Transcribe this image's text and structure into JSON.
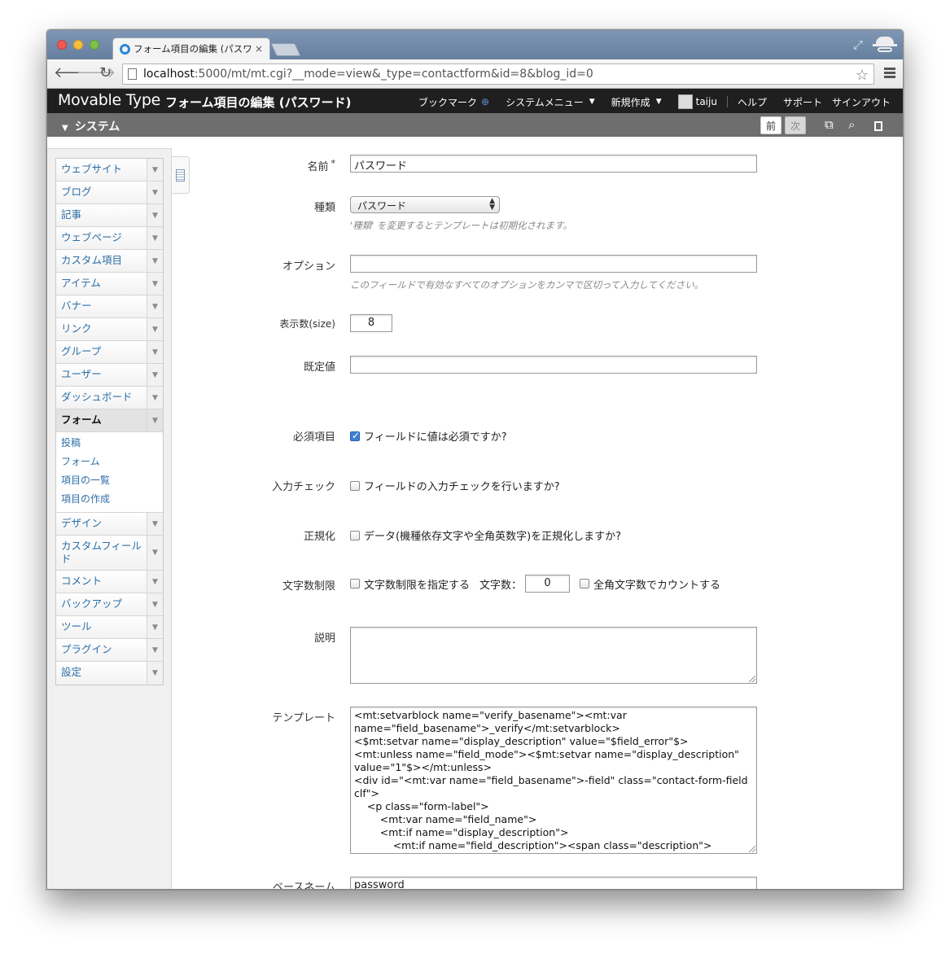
{
  "browser": {
    "tab_title": "フォーム項目の編集 (パスワ",
    "tab_close": "×",
    "url_host": "localhost",
    "url_path": ":5000/mt/mt.cgi?__mode=view&_type=contactform&id=8&blog_id=0"
  },
  "header": {
    "logo": "Movable Type",
    "page_title": "フォーム項目の編集 (パスワード)",
    "nav": {
      "bookmark": "ブックマーク",
      "system_menu": "システムメニュー",
      "new": "新規作成",
      "user": "taiju",
      "help": "ヘルプ",
      "support": "サポート",
      "signout": "サインアウト"
    }
  },
  "scope": {
    "title": "システム",
    "prev": "前",
    "next": "次"
  },
  "sidebar": {
    "items": [
      {
        "label": "ウェブサイト"
      },
      {
        "label": "ブログ"
      },
      {
        "label": "記事"
      },
      {
        "label": "ウェブページ"
      },
      {
        "label": "カスタム項目"
      },
      {
        "label": "アイテム"
      },
      {
        "label": "バナー"
      },
      {
        "label": "リンク"
      },
      {
        "label": "グループ"
      },
      {
        "label": "ユーザー"
      },
      {
        "label": "ダッシュボード"
      },
      {
        "label": "フォーム"
      },
      {
        "label": "デザイン"
      },
      {
        "label": "カスタムフィールド"
      },
      {
        "label": "コメント"
      },
      {
        "label": "バックアップ"
      },
      {
        "label": "ツール"
      },
      {
        "label": "プラグイン"
      },
      {
        "label": "設定"
      }
    ],
    "form_submenu": [
      "投稿",
      "フォーム",
      "項目の一覧",
      "項目の作成"
    ]
  },
  "form": {
    "name_label": "名前",
    "name_required": "*",
    "name_value": "パスワード",
    "type_label": "種類",
    "type_value": "パスワード",
    "type_hint": "'種類' を変更するとテンプレートは初期化されます。",
    "options_label": "オプション",
    "options_value": "",
    "options_hint": "このフィールドで有効なすべてのオプションをカンマで区切って入力してください。",
    "size_label": "表示数(size)",
    "size_value": "8",
    "default_label": "既定値",
    "default_value": "",
    "required_label": "必須項目",
    "required_text": "フィールドに値は必須ですか?",
    "required_checked": true,
    "validate_label": "入力チェック",
    "validate_text": "フィールドの入力チェックを行いますか?",
    "normalize_label": "正規化",
    "normalize_text": "データ(機種依存文字や全角英数字)を正規化しますか?",
    "charlimit_label": "文字数制限",
    "charlimit_text": "文字数制限を指定する",
    "charcount_label": "文字数：",
    "charcount_value": "0",
    "fullwidth_text": "全角文字数でカウントする",
    "description_label": "説明",
    "description_value": "",
    "template_label": "テンプレート",
    "template_value": "<mt:setvarblock name=\"verify_basename\"><mt:var name=\"field_basename\">_verify</mt:setvarblock>\n<$mt:setvar name=\"display_description\" value=\"$field_error\"$>\n<mt:unless name=\"field_mode\"><$mt:setvar name=\"display_description\" value=\"1\"$></mt:unless>\n<div id=\"<mt:var name=\"field_basename\">-field\" class=\"contact-form-field clf\">\n    <p class=\"form-label\">\n        <mt:var name=\"field_name\">\n        <mt:if name=\"display_description\">\n            <mt:if name=\"field_description\"><span class=\"description\"><mt:var",
    "basename_label": "ベースネーム",
    "basename_value": "password"
  }
}
